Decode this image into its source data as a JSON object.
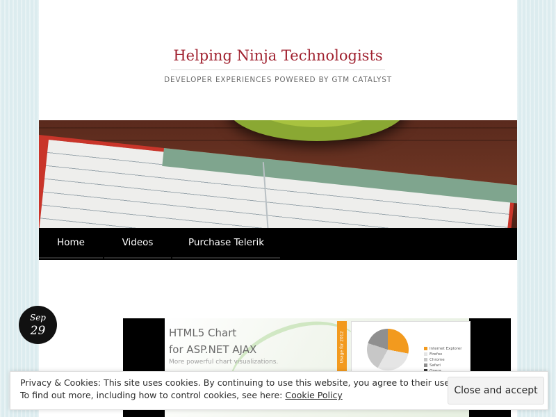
{
  "site": {
    "title": "Helping Ninja Technologists",
    "description": "DEVELOPER EXPERIENCES POWERED BY GTM CATALYST"
  },
  "nav": {
    "items": [
      {
        "label": "Home"
      },
      {
        "label": "Videos"
      },
      {
        "label": "Purchase Telerik"
      }
    ]
  },
  "post": {
    "date": {
      "month": "Sep",
      "day": "29"
    },
    "featured_image": {
      "line1": "HTML5 Chart",
      "line2": "for ASP.NET AJAX",
      "line3": "More powerful chart visualizations.",
      "strip_label": "Usage for 2012",
      "legend": [
        {
          "label": "Internet Explorer",
          "color": "#f29a1e"
        },
        {
          "label": "Firefox",
          "color": "#e5e5e5"
        },
        {
          "label": "Chrome",
          "color": "#c7c7c7"
        },
        {
          "label": "Safari",
          "color": "#8f8f8f"
        },
        {
          "label": "Opera",
          "color": "#333333"
        }
      ]
    }
  },
  "cookie_banner": {
    "line1": "Privacy & Cookies: This site uses cookies. By continuing to use this website, you agree to their use.",
    "line2_prefix": "To find out more, including how to control cookies, see here: ",
    "policy_link": "Cookie Policy",
    "button": "Close and accept"
  },
  "colors": {
    "title": "#a0212f",
    "nav_bg": "#000000",
    "page_bg": "#dcecef"
  }
}
